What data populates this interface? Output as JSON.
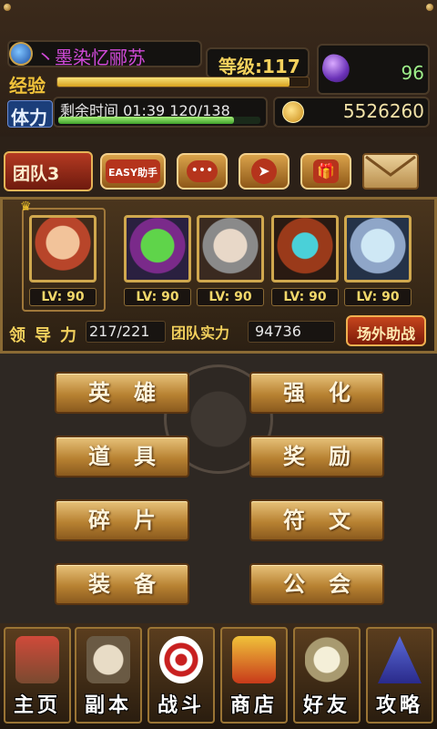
{
  "player": {
    "name": "丶墨染忆郦苏",
    "level_label": "等级:117",
    "exp_label": "经验",
    "exp_progress": 0.93,
    "stamina_label": "体力",
    "stamina_timer_text": "剩余时间  01:39  120/138",
    "stamina_progress": 0.87,
    "gems": "96",
    "gold": "5526260"
  },
  "toolbar": {
    "team_label": "团队3",
    "easy_label": "EASY助手"
  },
  "heroes": {
    "leader_lv": "LV: 90",
    "members": [
      {
        "lv": "LV: 90"
      },
      {
        "lv": "LV: 90"
      },
      {
        "lv": "LV: 90"
      },
      {
        "lv": "LV: 90"
      }
    ],
    "leadership_label": "领导力",
    "leadership_value": "217/221",
    "team_power_label": "团队实力",
    "team_power_value": "94736",
    "assist_label": "场外助战"
  },
  "menu": {
    "hero": "英雄",
    "enhance": "强化",
    "items": "道具",
    "rewards": "奖励",
    "fragments": "碎片",
    "runes": "符文",
    "equipment": "装备",
    "guild": "公会"
  },
  "nav": {
    "home": "主页",
    "dungeon": "副本",
    "battle": "战斗",
    "shop": "商店",
    "friends": "好友",
    "guide": "攻略"
  },
  "colors": {
    "gold_accent": "#f3d15d",
    "name_color": "#d04ad8",
    "gem_color": "#9ef08a"
  }
}
